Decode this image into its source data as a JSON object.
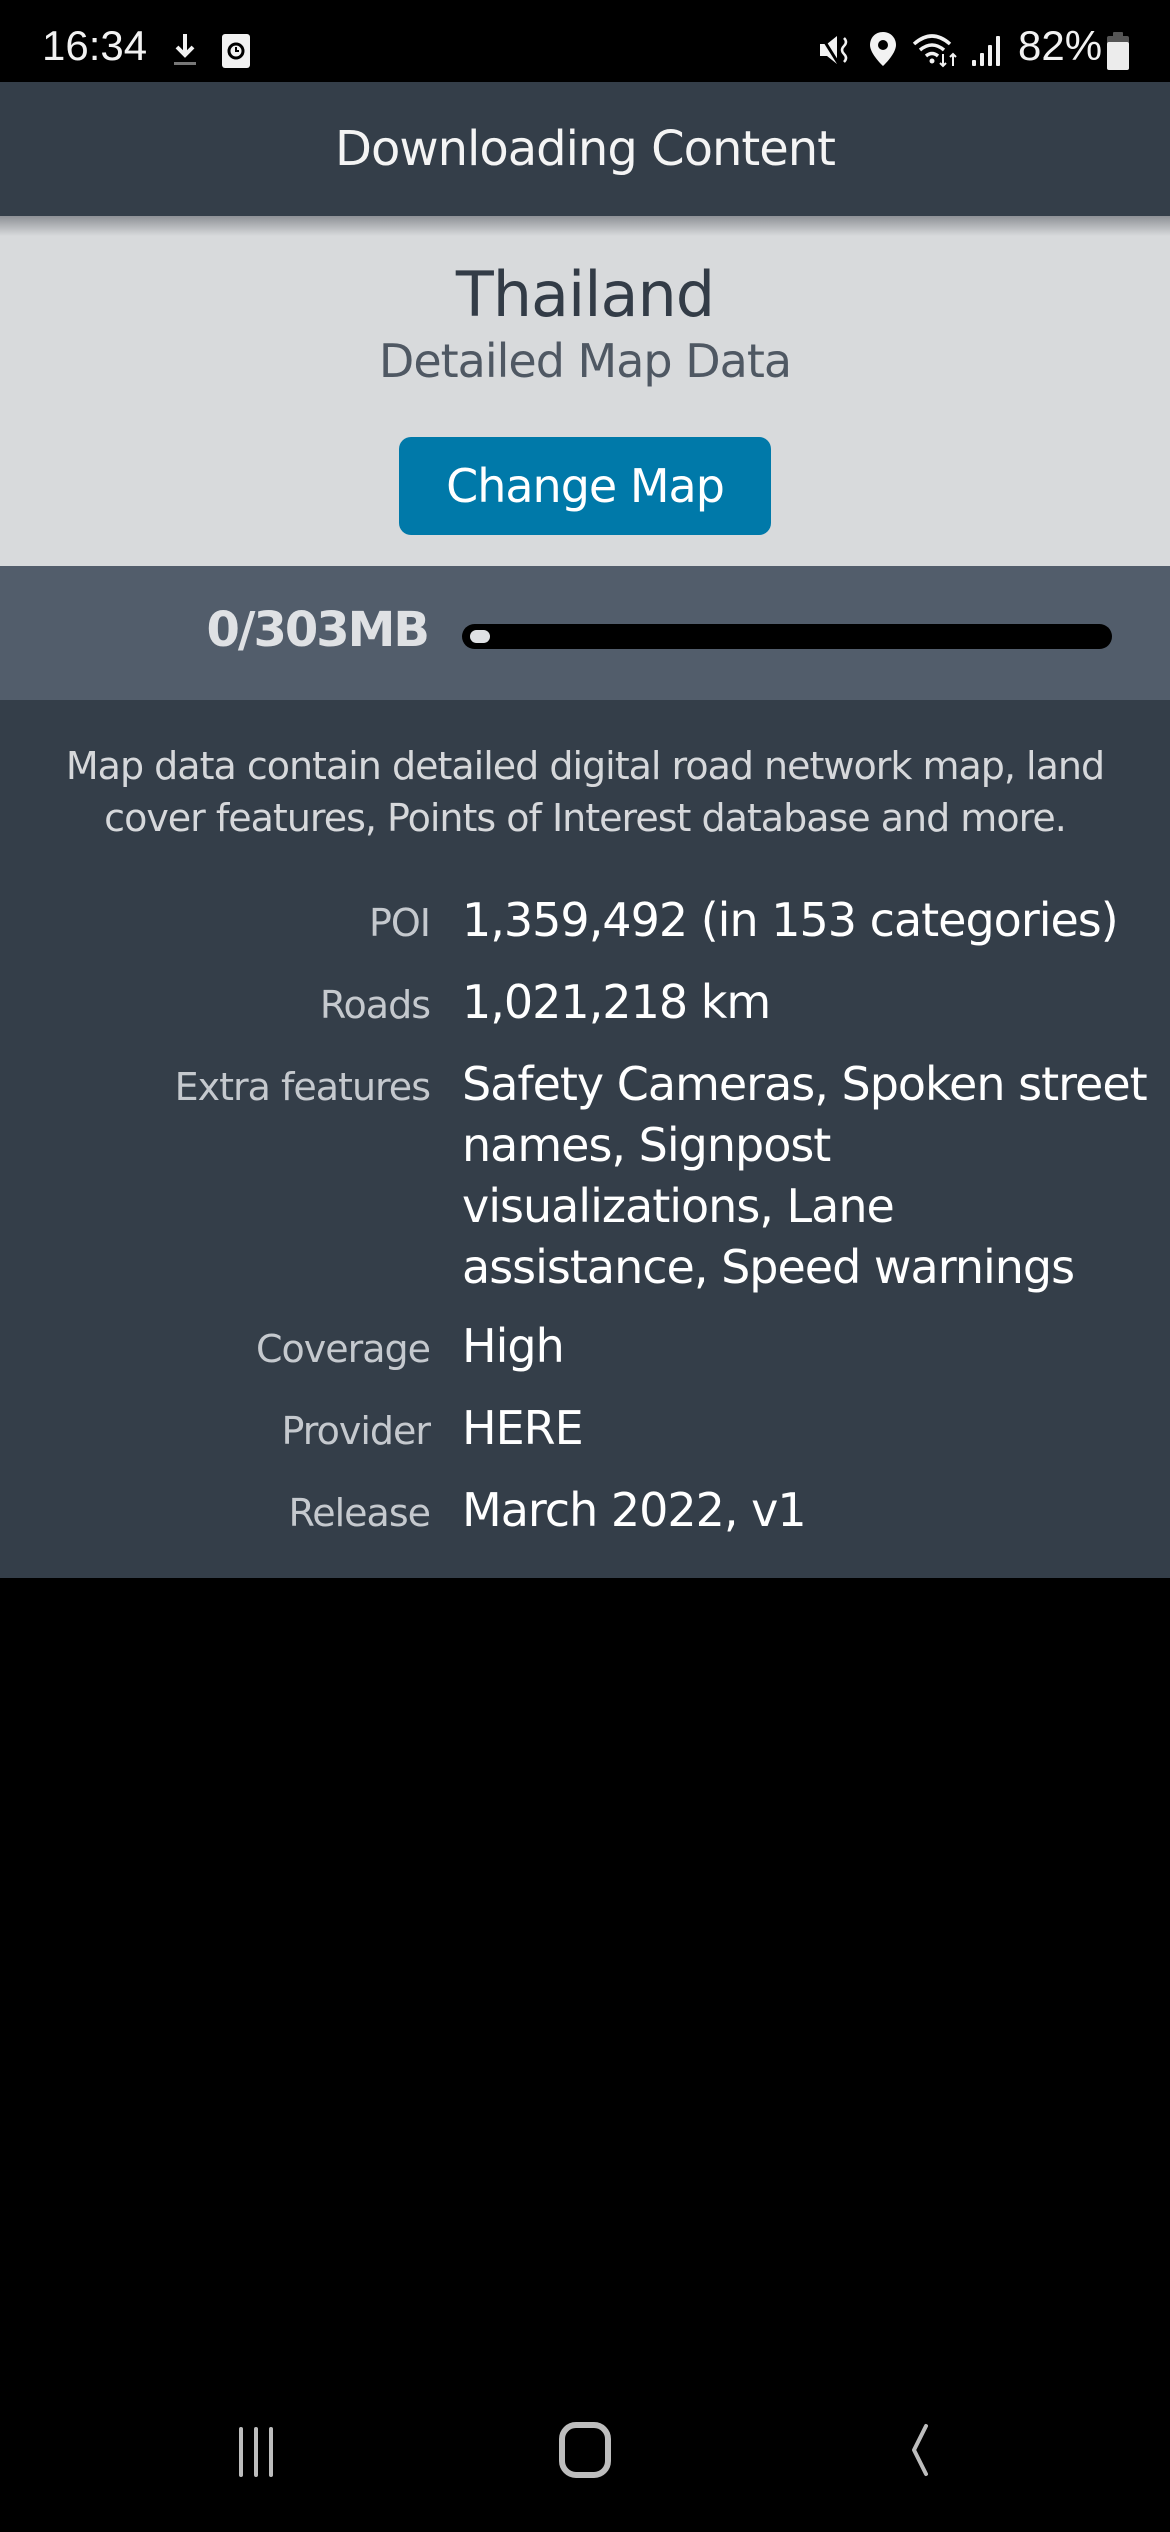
{
  "status_bar": {
    "time": "16:34",
    "battery_percent": "82%",
    "icons": [
      "download-icon",
      "clock-icon",
      "mute-icon",
      "location-icon",
      "wifi-icon",
      "signal-icon",
      "battery-icon"
    ]
  },
  "header": {
    "title": "Downloading Content"
  },
  "map": {
    "country": "Thailand",
    "subtitle": "Detailed Map Data",
    "change_button_label": "Change Map",
    "accent_color": "#0079a9"
  },
  "download": {
    "size_label": "0/303MB",
    "downloaded_mb": 0,
    "total_mb": 303,
    "progress_fraction": 0
  },
  "details": {
    "description": "Map data contain detailed digital road network map, land cover features, Points of Interest database and more.",
    "rows": [
      {
        "label": "POI",
        "value": "1,359,492 (in 153 categories)"
      },
      {
        "label": "Roads",
        "value": "1,021,218 km"
      },
      {
        "label": "Extra features",
        "value": "Safety Cameras, Spoken street names, Signpost visualizations, Lane assistance, Speed warnings"
      },
      {
        "label": "Coverage",
        "value": "High"
      },
      {
        "label": "Provider",
        "value": "HERE"
      },
      {
        "label": "Release",
        "value": "March 2022, v1"
      }
    ]
  },
  "nav_bar": {
    "buttons": [
      "recents",
      "home",
      "back"
    ]
  }
}
